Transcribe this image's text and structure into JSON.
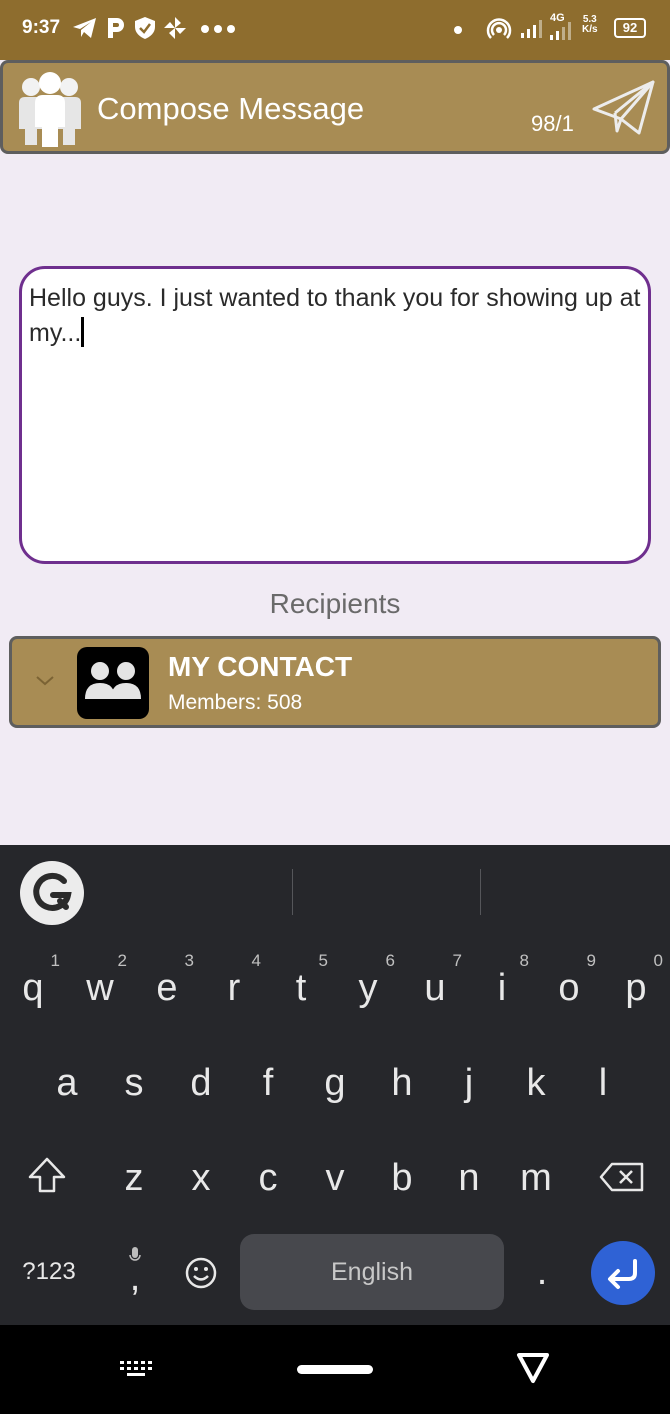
{
  "status_bar": {
    "time": "9:37",
    "network_type": "4G",
    "speed_value": "5.3",
    "speed_unit": "K/s",
    "battery": "92",
    "icons": [
      "telegram-icon",
      "p-icon",
      "shield-icon",
      "pinwheel-icon",
      "more-dots-icon",
      "dot-icon",
      "hotspot-icon",
      "signal-icon",
      "signal-4g-icon",
      "battery-icon"
    ]
  },
  "header": {
    "title": "Compose Message",
    "count": "98/1",
    "icons": [
      "group-logo-icon",
      "send-plane-icon"
    ]
  },
  "message": {
    "text": "Hello guys. I just wanted to thank you for showing up at my..."
  },
  "recipients": {
    "label": "Recipients",
    "group": {
      "name": "MY CONTACT",
      "members": "Members: 508"
    }
  },
  "keyboard": {
    "row1": [
      {
        "key": "q",
        "hint": "1"
      },
      {
        "key": "w",
        "hint": "2"
      },
      {
        "key": "e",
        "hint": "3"
      },
      {
        "key": "r",
        "hint": "4"
      },
      {
        "key": "t",
        "hint": "5"
      },
      {
        "key": "y",
        "hint": "6"
      },
      {
        "key": "u",
        "hint": "7"
      },
      {
        "key": "i",
        "hint": "8"
      },
      {
        "key": "o",
        "hint": "9"
      },
      {
        "key": "p",
        "hint": "0"
      }
    ],
    "row2": [
      "a",
      "s",
      "d",
      "f",
      "g",
      "h",
      "j",
      "k",
      "l"
    ],
    "row3": [
      "z",
      "x",
      "c",
      "v",
      "b",
      "n",
      "m"
    ],
    "symbols_key": "?123",
    "period_key": ".",
    "comma_key": ",",
    "space_label": "English",
    "accent_color": "#2f62d5"
  },
  "colors": {
    "status_bar": "#8e6d2e",
    "header": "#a88c54",
    "message_border": "#6f2f8e",
    "keyboard_bg": "#26272b"
  }
}
